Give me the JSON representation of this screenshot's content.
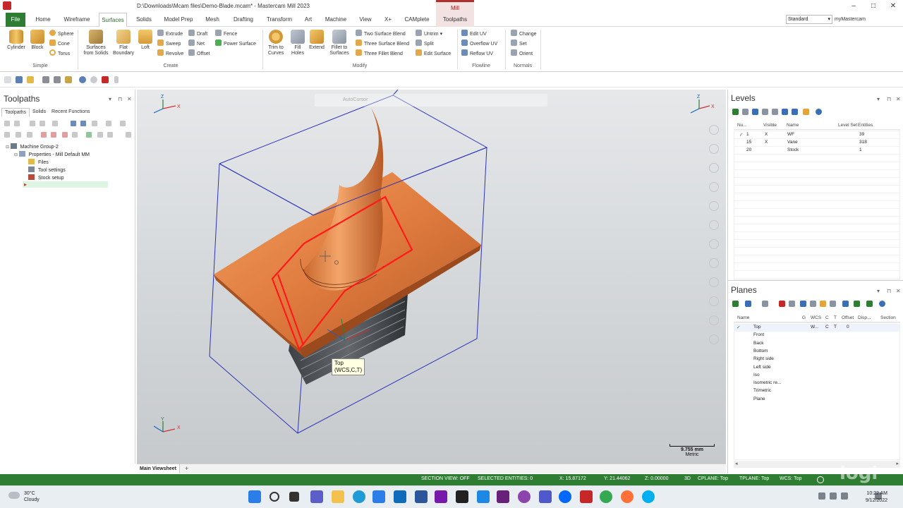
{
  "app": {
    "title": "D:\\Downloads\\Mcam files\\Demo-Blade.mcam* - Mastercam Mill 2023",
    "context_tab": "Mill",
    "window_controls": [
      "–",
      "□",
      "✕"
    ]
  },
  "tabs": [
    "File",
    "Home",
    "Wireframe",
    "Surfaces",
    "Solids",
    "Model Prep",
    "Mesh",
    "Drafting",
    "Transform",
    "Art",
    "Machine",
    "View",
    "X+",
    "CAMplete",
    "Toolpaths"
  ],
  "standard_select": "Standard",
  "mymastercam": "myMastercam",
  "ribbon": {
    "simple": {
      "label": "Simple",
      "cylinder": "Cylinder",
      "block": "Block",
      "sphere": "Sphere",
      "cone": "Cone",
      "torus": "Torus"
    },
    "create": {
      "label": "Create",
      "surfaces_from_solids_1": "Surfaces",
      "surfaces_from_solids_2": "from Solids",
      "flat_boundary_1": "Flat",
      "flat_boundary_2": "Boundary",
      "loft": "Loft",
      "extrude": "Extrude",
      "sweep": "Sweep",
      "revolve": "Revolve",
      "draft": "Draft",
      "net": "Net",
      "offset": "Offset",
      "fence": "Fence",
      "power_surface": "Power Surface"
    },
    "modify": {
      "label": "Modify",
      "trim_1": "Trim to",
      "trim_2": "Curves",
      "fill_1": "Fill",
      "fill_2": "Holes",
      "extend": "Extend",
      "fillet_1": "Fillet to",
      "fillet_2": "Surfaces",
      "two_surface_blend": "Two Surface Blend",
      "three_surface_blend": "Three Surface Blend",
      "three_fillet_blend": "Three Fillet Blend",
      "untrim": "Untrim",
      "split": "Split",
      "edit_surface": "Edit Surface"
    },
    "flowline": {
      "label": "Flowline",
      "edit_uv": "Edit UV",
      "overflow_uv": "Overflow UV",
      "reflow_uv": "Reflow UV"
    },
    "normals": {
      "label": "Normals",
      "change": "Change",
      "set": "Set",
      "orient": "Orient"
    }
  },
  "toolpaths_panel": {
    "title": "Toolpaths",
    "subtabs": [
      "Toolpaths",
      "Solids",
      "Recent Functions"
    ],
    "tree": [
      {
        "label": "Machine Group-2"
      },
      {
        "label": "Properties - Mill Default MM"
      },
      {
        "label": "Files"
      },
      {
        "label": "Tool settings"
      },
      {
        "label": "Stock setup"
      }
    ],
    "insert_arrow": "▸"
  },
  "viewport": {
    "autocursor": "AutoCursor",
    "tooltip_line1": "Top",
    "tooltip_line2": "(WCS,C,T)",
    "scale_value": "9.755 mm",
    "scale_unit": "Metric",
    "axis_x": "X",
    "axis_y": "Y",
    "axis_z": "Z"
  },
  "sheet_tabs": {
    "main": "Main Viewsheet",
    "add": "+"
  },
  "levels": {
    "title": "Levels",
    "columns": [
      "Nu...",
      "Visible",
      "Name",
      "Level Set",
      "Entities"
    ],
    "rows": [
      {
        "check": "✓",
        "number": "1",
        "visible": "X",
        "name": "WF",
        "level_set": "",
        "entities": "39"
      },
      {
        "check": "",
        "number": "15",
        "visible": "X",
        "name": "Vane",
        "level_set": "",
        "entities": "318"
      },
      {
        "check": "",
        "number": "20",
        "visible": "",
        "name": "Stock",
        "level_set": "",
        "entities": "1"
      }
    ]
  },
  "planes": {
    "title": "Planes",
    "columns": [
      "Name",
      "G",
      "WCS",
      "C",
      "T",
      "Offset",
      "Disp...",
      "Section"
    ],
    "rows": [
      {
        "check": "✓",
        "name": "Top",
        "wcs": "W...",
        "c": "C",
        "t": "T",
        "offset": "0"
      },
      {
        "check": "",
        "name": "Front",
        "wcs": "",
        "c": "",
        "t": "",
        "offset": ""
      },
      {
        "check": "",
        "name": "Back",
        "wcs": "",
        "c": "",
        "t": "",
        "offset": ""
      },
      {
        "check": "",
        "name": "Bottom",
        "wcs": "",
        "c": "",
        "t": "",
        "offset": ""
      },
      {
        "check": "",
        "name": "Right side",
        "wcs": "",
        "c": "",
        "t": "",
        "offset": ""
      },
      {
        "check": "",
        "name": "Left side",
        "wcs": "",
        "c": "",
        "t": "",
        "offset": ""
      },
      {
        "check": "",
        "name": "Iso",
        "wcs": "",
        "c": "",
        "t": "",
        "offset": ""
      },
      {
        "check": "",
        "name": "Isometric re...",
        "wcs": "",
        "c": "",
        "t": "",
        "offset": ""
      },
      {
        "check": "",
        "name": "Trimetric",
        "wcs": "",
        "c": "",
        "t": "",
        "offset": ""
      },
      {
        "check": "",
        "name": "Plane",
        "wcs": "",
        "c": "",
        "t": "",
        "offset": ""
      }
    ]
  },
  "status": {
    "section_view": "SECTION VIEW: OFF",
    "selected": "SELECTED ENTITIES: 0",
    "x": "X:   15.87172",
    "y": "Y:   21.44062",
    "z": "Z:   0.00000",
    "mode": "3D",
    "cplane": "CPLANE: Top",
    "tplane": "TPLANE: Top",
    "wcs": "WCS: Top"
  },
  "taskbar": {
    "temp": "30°C",
    "weather": "Cloudy",
    "time": "10:22 AM",
    "date": "9/12/2022"
  },
  "watermark": "logi",
  "colors": {
    "accent_green": "#2e7d32",
    "surface_orange": "#e07b3e",
    "selection_red": "#ff1a1a",
    "stock_blue": "#2b33b8"
  }
}
